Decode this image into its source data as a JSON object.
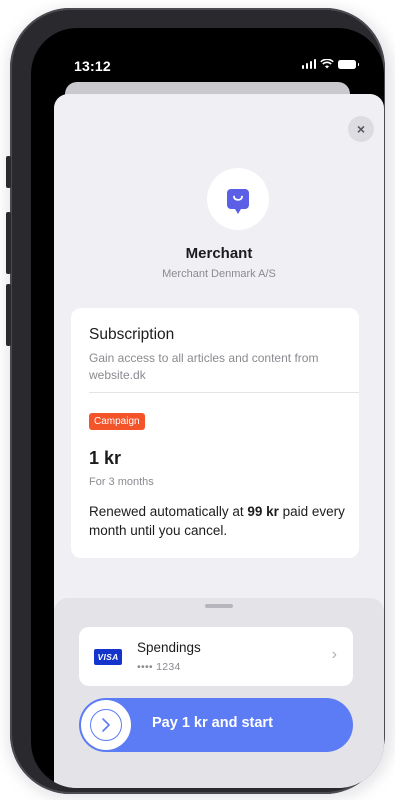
{
  "status_bar": {
    "time": "13:12"
  },
  "sheet": {
    "close_label": "×"
  },
  "merchant": {
    "logo_icon": "shopping-bag-icon",
    "name": "Merchant",
    "legal_name": "Merchant Denmark A/S"
  },
  "subscription": {
    "title": "Subscription",
    "description": "Gain access to all articles and content from website.dk",
    "badge": "Campaign",
    "price": "1 kr",
    "period": "For 3 months",
    "renew_prefix": "Renewed automatically at ",
    "renew_amount": "99 kr",
    "renew_suffix": " paid every month until you cancel."
  },
  "payment": {
    "card_brand": "VISA",
    "card_name": "Spendings",
    "card_number": "•••• 1234",
    "chevron": "›"
  },
  "action": {
    "label": "Pay 1 kr and start",
    "knob_icon": "chevron-right-icon"
  },
  "colors": {
    "accent": "#5c7cf6",
    "merchant_brand": "#5b5fe6",
    "campaign": "#f4542a",
    "visa": "#1434cb"
  }
}
